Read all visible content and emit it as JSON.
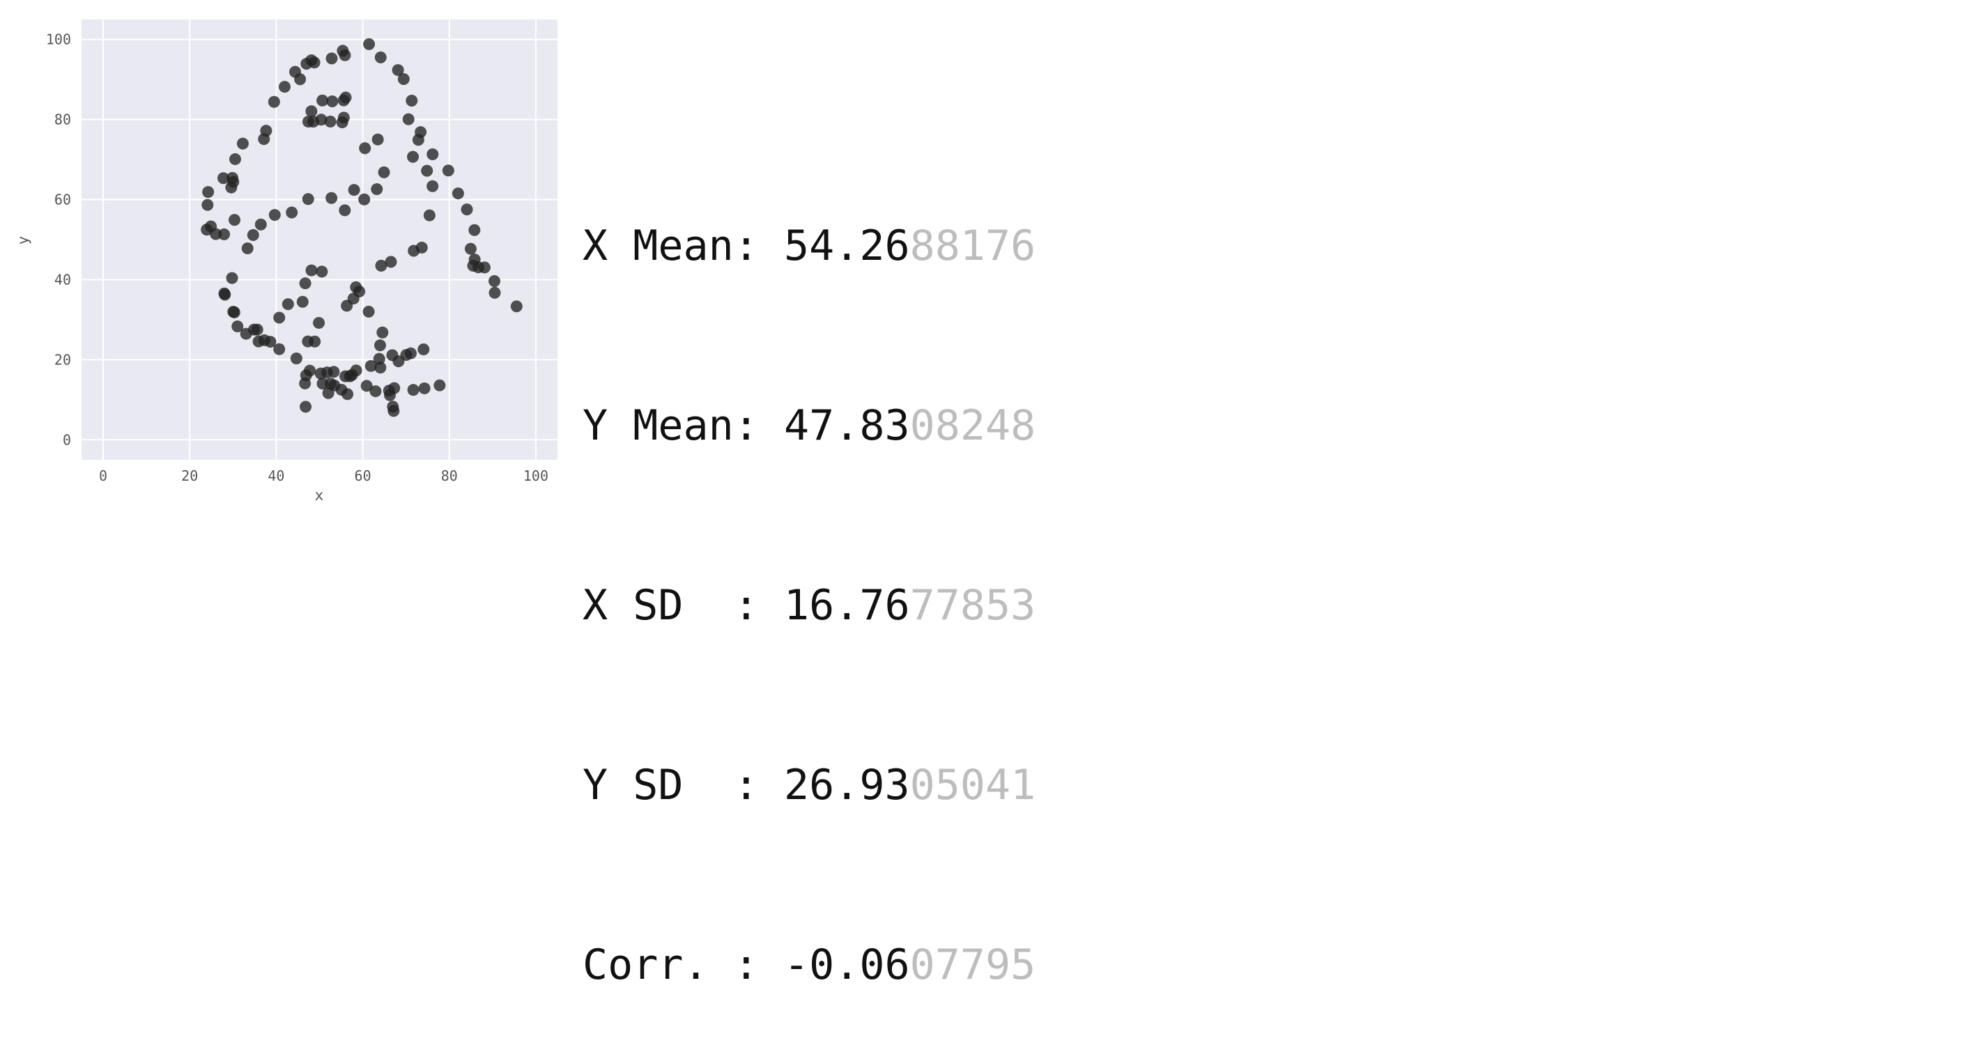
{
  "chart_data": {
    "type": "scatter",
    "xlabel": "x",
    "ylabel": "y",
    "xlim": [
      -5,
      105
    ],
    "ylim": [
      -5,
      105
    ],
    "xticks": [
      0,
      20,
      40,
      60,
      80,
      100
    ],
    "yticks": [
      0,
      20,
      40,
      60,
      80,
      100
    ],
    "grid": true,
    "background": "#e9e9f1",
    "grid_color": "#ffffff",
    "point_color": "#222222",
    "point_alpha": 0.78,
    "points": [
      [
        55.38,
        97.18
      ],
      [
        61.45,
        98.85
      ],
      [
        48.81,
        94.25
      ],
      [
        48.13,
        94.81
      ],
      [
        46.99,
        93.94
      ],
      [
        52.82,
        95.27
      ],
      [
        55.88,
        96.07
      ],
      [
        64.14,
        95.54
      ],
      [
        44.37,
        91.92
      ],
      [
        45.51,
        90.08
      ],
      [
        68.14,
        92.37
      ],
      [
        69.46,
        90.11
      ],
      [
        41.95,
        88.19
      ],
      [
        39.51,
        84.42
      ],
      [
        50.67,
        84.77
      ],
      [
        52.95,
        84.55
      ],
      [
        55.59,
        84.79
      ],
      [
        56.05,
        85.52
      ],
      [
        55.62,
        80.48
      ],
      [
        71.31,
        84.72
      ],
      [
        48.13,
        82.08
      ],
      [
        47.42,
        79.49
      ],
      [
        48.56,
        79.48
      ],
      [
        50.4,
        79.97
      ],
      [
        52.51,
        79.5
      ],
      [
        55.26,
        79.31
      ],
      [
        70.57,
        80.08
      ],
      [
        73.37,
        76.86
      ],
      [
        37.66,
        77.21
      ],
      [
        37.16,
        75.13
      ],
      [
        72.85,
        74.93
      ],
      [
        63.47,
        75.03
      ],
      [
        32.27,
        74.0
      ],
      [
        60.5,
        72.85
      ],
      [
        76.14,
        71.32
      ],
      [
        71.59,
        70.69
      ],
      [
        30.51,
        70.11
      ],
      [
        79.77,
        67.28
      ],
      [
        64.91,
        66.82
      ],
      [
        74.84,
        67.21
      ],
      [
        27.78,
        65.37
      ],
      [
        29.88,
        65.43
      ],
      [
        30.08,
        64.43
      ],
      [
        29.61,
        63.04
      ],
      [
        63.25,
        62.61
      ],
      [
        57.99,
        62.43
      ],
      [
        76.12,
        63.36
      ],
      [
        24.26,
        61.91
      ],
      [
        82.04,
        61.55
      ],
      [
        47.38,
        60.14
      ],
      [
        52.76,
        60.4
      ],
      [
        60.34,
        60.05
      ],
      [
        24.13,
        58.68
      ],
      [
        84.07,
        57.55
      ],
      [
        55.85,
        57.34
      ],
      [
        39.66,
        56.17
      ],
      [
        43.59,
        56.79
      ],
      [
        75.43,
        56.07
      ],
      [
        30.36,
        54.94
      ],
      [
        36.44,
        53.79
      ],
      [
        23.94,
        52.5
      ],
      [
        24.89,
        53.3
      ],
      [
        26.03,
        51.39
      ],
      [
        27.95,
        51.32
      ],
      [
        85.81,
        52.4
      ],
      [
        34.67,
        51.15
      ],
      [
        33.37,
        47.82
      ],
      [
        73.64,
        48.01
      ],
      [
        71.77,
        47.21
      ],
      [
        84.94,
        47.72
      ],
      [
        85.51,
        43.49
      ],
      [
        86.71,
        43.09
      ],
      [
        88.16,
        43.06
      ],
      [
        85.86,
        45.03
      ],
      [
        66.51,
        44.45
      ],
      [
        64.25,
        43.49
      ],
      [
        90.43,
        39.64
      ],
      [
        90.51,
        36.73
      ],
      [
        95.55,
        33.34
      ],
      [
        29.79,
        40.41
      ],
      [
        28.14,
        36.25
      ],
      [
        28.01,
        36.56
      ],
      [
        46.71,
        39.09
      ],
      [
        48.14,
        42.33
      ],
      [
        50.55,
        42.01
      ],
      [
        58.42,
        38.12
      ],
      [
        57.85,
        35.28
      ],
      [
        59.2,
        37.05
      ],
      [
        42.73,
        33.88
      ],
      [
        46.1,
        34.46
      ],
      [
        56.31,
        33.49
      ],
      [
        61.37,
        32.01
      ],
      [
        30.07,
        31.99
      ],
      [
        30.33,
        31.84
      ],
      [
        40.7,
        30.5
      ],
      [
        49.85,
        29.21
      ],
      [
        31.04,
        28.33
      ],
      [
        33.04,
        26.49
      ],
      [
        64.55,
        26.81
      ],
      [
        35.63,
        27.52
      ],
      [
        34.86,
        27.53
      ],
      [
        37.27,
        24.88
      ],
      [
        35.92,
        24.57
      ],
      [
        38.64,
        24.49
      ],
      [
        47.31,
        24.57
      ],
      [
        48.91,
        24.55
      ],
      [
        64.01,
        23.6
      ],
      [
        40.69,
        22.64
      ],
      [
        74.05,
        22.59
      ],
      [
        66.83,
        21.14
      ],
      [
        71.1,
        21.6
      ],
      [
        70.05,
        21.2
      ],
      [
        44.66,
        20.33
      ],
      [
        63.81,
        20.22
      ],
      [
        68.27,
        19.61
      ],
      [
        61.88,
        18.44
      ],
      [
        64.07,
        18.03
      ],
      [
        47.76,
        17.27
      ],
      [
        46.9,
        16.1
      ],
      [
        50.28,
        16.55
      ],
      [
        51.75,
        16.82
      ],
      [
        53.29,
        16.97
      ],
      [
        55.98,
        15.86
      ],
      [
        57.03,
        15.86
      ],
      [
        57.51,
        16.2
      ],
      [
        58.48,
        17.32
      ],
      [
        46.65,
        14.08
      ],
      [
        50.73,
        14.04
      ],
      [
        52.56,
        14.01
      ],
      [
        53.43,
        13.57
      ],
      [
        60.9,
        13.48
      ],
      [
        77.76,
        13.6
      ],
      [
        74.26,
        12.85
      ],
      [
        55.09,
        12.5
      ],
      [
        52.04,
        11.66
      ],
      [
        56.46,
        11.4
      ],
      [
        62.96,
        12.13
      ],
      [
        66.07,
        12.28
      ],
      [
        67.27,
        12.9
      ],
      [
        71.68,
        12.46
      ],
      [
        66.27,
        11.14
      ],
      [
        46.79,
        8.25
      ],
      [
        66.96,
        8.27
      ],
      [
        67.13,
        7.21
      ]
    ]
  },
  "stats": [
    {
      "label": "X Mean: ",
      "shown": "54.26",
      "faded": "88176"
    },
    {
      "label": "Y Mean: ",
      "shown": "47.83",
      "faded": "08248"
    },
    {
      "label": "X SD  : ",
      "shown": "16.76",
      "faded": "77853"
    },
    {
      "label": "Y SD  : ",
      "shown": "26.93",
      "faded": "05041"
    },
    {
      "label": "Corr. : ",
      "shown": "-0.06",
      "faded": "07795"
    }
  ]
}
